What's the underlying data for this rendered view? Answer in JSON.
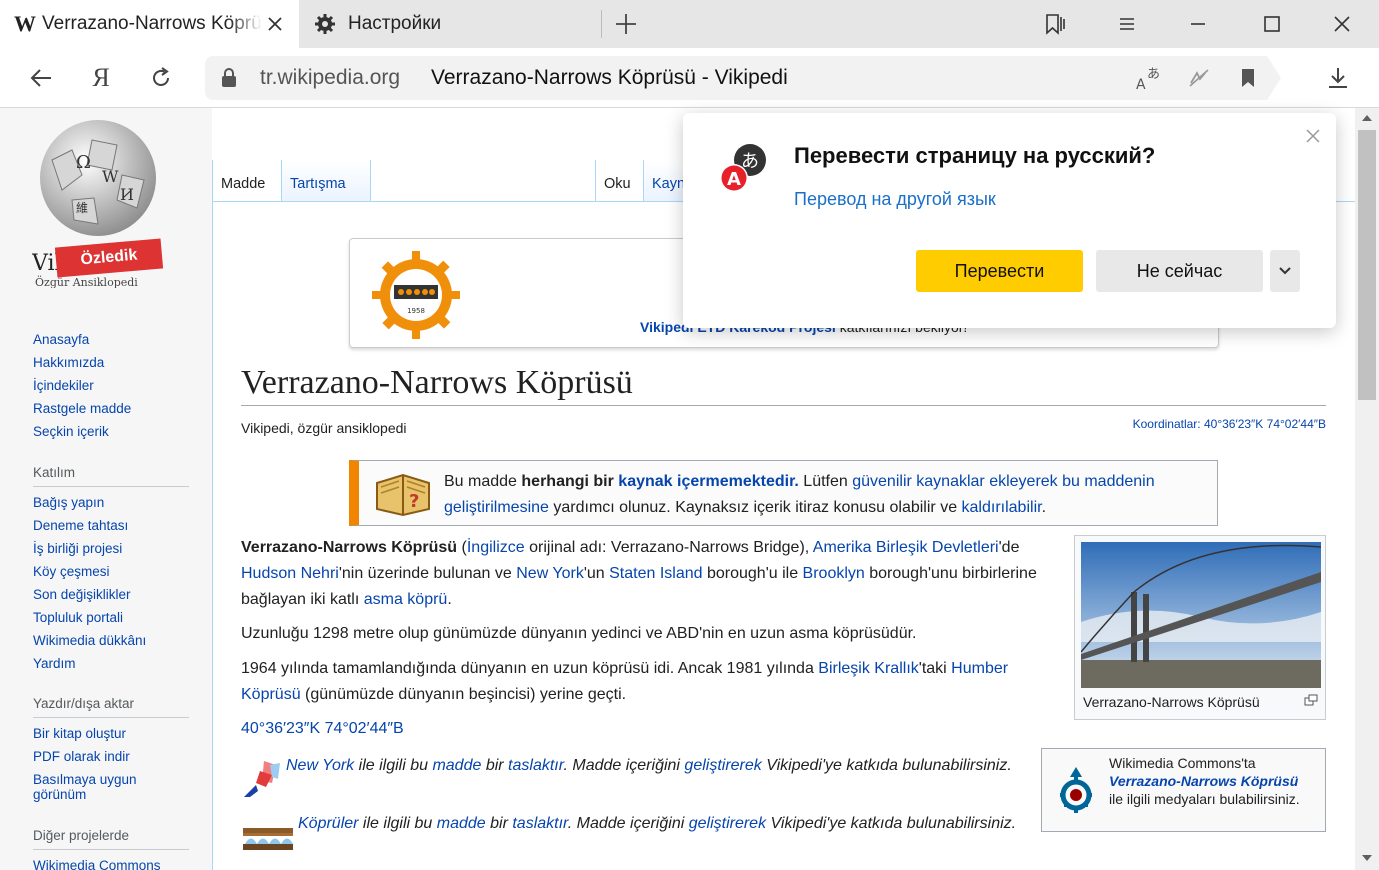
{
  "tabs": {
    "wiki": {
      "favicon": "W",
      "title": "Verrazano-Narrows Köprüsü - Vikipedi"
    },
    "settings": {
      "title": "Настройки"
    }
  },
  "toolbar": {
    "ya_label": "Я",
    "url_domain": "tr.wikipedia.org",
    "url_title": "Verrazano-Narrows Köprüsü - Vikipedi"
  },
  "icons": [
    "w-favicon",
    "close-icon",
    "gear-icon",
    "plus-icon",
    "bookmarks-panel-icon",
    "menu-icon",
    "minimize-icon",
    "maximize-icon",
    "back-icon",
    "reload-icon",
    "lock-icon",
    "translate-icon",
    "reader-off-icon",
    "bookmark-icon",
    "download-icon"
  ],
  "sidebar": {
    "badge": "Özledik",
    "nav_main": [
      "Anasayfa",
      "Hakkımızda",
      "İçindekiler",
      "Rastgele madde",
      "Seçkin içerik"
    ],
    "katilim": {
      "heading": "Katılım",
      "items": [
        "Bağış yapın",
        "Deneme tahtası",
        "İş birliği projesi",
        "Köy çeşmesi",
        "Son değişiklikler",
        "Topluluk portali",
        "Wikimedia dükkânı",
        "Yardım"
      ]
    },
    "yazdir": {
      "heading": "Yazdır/dışa aktar",
      "items": [
        "Bir kitap oluştur",
        "PDF olarak indir",
        "Basılmaya uygun görünüm"
      ]
    },
    "diger": {
      "heading": "Diğer projelerde",
      "items": [
        "Wikimedia Commons"
      ]
    }
  },
  "page_tabs": {
    "madde": "Madde",
    "tartisma": "Tartışma",
    "oku": "Oku",
    "kaynak": "Kayn"
  },
  "banner": {
    "link": "Vikipedi ETD Karekod Projesi",
    "rest": " katkılarınızı bekliyor!",
    "seal_year": "1958"
  },
  "article": {
    "title": "Verrazano-Narrows Köprüsü",
    "site_sub": "Vikipedi, özgür ansiklopedi",
    "coords_top": "Koordinatlar: 40°36′23″K 74°02′44″B",
    "ambox": {
      "t1": "Bu madde ",
      "t2": "herhangi bir ",
      "t3": "kaynak içermemektedir.",
      "t4": " Lütfen ",
      "t5": "güvenilir kaynaklar ekleyerek bu maddenin geliştirilmesine",
      "t6": " yardımcı olunuz. Kaynaksız içerik itiraz konusu olabilir ve ",
      "t7": "kaldırılabilir",
      "t8": "."
    },
    "p1": {
      "b": "Verrazano-Narrows Köprüsü",
      "s1": " (",
      "l1": "İngilizce",
      "s2": " orijinal adı: Verrazano-Narrows Bridge), ",
      "l2": "Amerika Birleşik Devletleri",
      "s3": "'de ",
      "l3": "Hudson Nehri",
      "s4": "'nin üzerinde bulunan ve ",
      "l4": "New York",
      "s5": "'un ",
      "l5": "Staten Island",
      "s6": " borough'u ile ",
      "l6": "Brooklyn",
      "s7": " borough'unu birbirlerine bağlayan iki katlı ",
      "l7": "asma köprü",
      "s8": "."
    },
    "p2": "Uzunluğu 1298 metre olup günümüzde dünyanın yedinci ve ABD'nin en uzun asma köprüsüdür.",
    "p3": {
      "s1": "1964 yılında tamamlandığında dünyanın en uzun köprüsü idi. Ancak 1981 yılında ",
      "l1": "Birleşik Krallık",
      "s2": "'taki ",
      "l2": "Humber Köprüsü",
      "s3": " (günümüzde dünyanın beşincisi) yerine geçti."
    },
    "coords": "40°36′23″K 74°02′44″B",
    "infobox_caption": "Verrazano-Narrows Köprüsü",
    "stub1": {
      "l1": "New York",
      "s1": " ile ilgili bu ",
      "l2": "madde",
      "s2": " bir ",
      "l3": "taslaktır",
      "s3": ". Madde içeriğini ",
      "l4": "geliştirerek",
      "s4": " Vikipedi'ye katkıda bulunabilirsiniz."
    },
    "stub2": {
      "l1": "Köprüler",
      "s1": " ile ilgili bu ",
      "l2": "madde",
      "s2": " bir ",
      "l3": "taslaktır",
      "s3": ". Madde içeriğini ",
      "l4": "geliştirerek",
      "s4": " Vikipedi'ye katkıda bulunabilirsiniz."
    },
    "commons": {
      "s1": "Wikimedia Commons'ta",
      "l1": "Verrazano-Narrows Köprüsü",
      "s2": "ile ilgili medyaları bulabilirsiniz."
    }
  },
  "popup": {
    "title": "Перевести страницу на русский?",
    "link": "Перевод на другой язык",
    "translate": "Перевести",
    "later": "Не сейчас",
    "icon_letter": "A",
    "icon_glyph": "あ"
  },
  "colors": {
    "accent_yellow": "#ffcc00",
    "link": "#0645ad",
    "popup_link": "#1a6fc8",
    "ambox_orange": "#f28500",
    "badge_red": "#dd3333"
  }
}
